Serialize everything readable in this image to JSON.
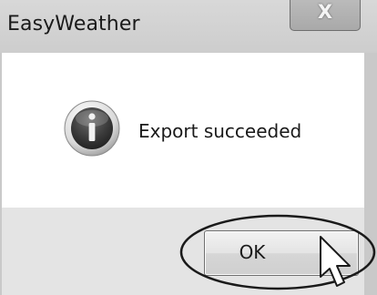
{
  "window": {
    "title": "EasyWeather",
    "close_glyph": "X"
  },
  "dialog": {
    "icon": "information-icon",
    "message": "Export succeeded",
    "ok_label": "OK"
  },
  "colors": {
    "titlebar": "#d0d0d0",
    "content_bg": "#ffffff",
    "button_strip": "#e4e4e4",
    "icon_ring": "#e8e8e8",
    "icon_core": "#3a3a3a"
  }
}
